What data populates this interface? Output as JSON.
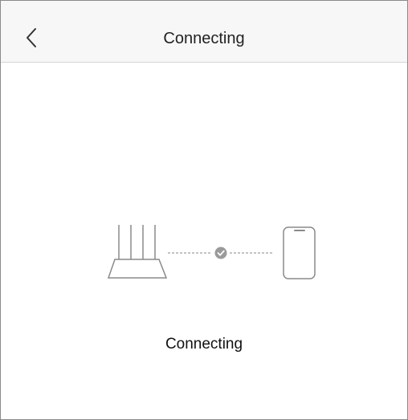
{
  "header": {
    "title": "Connecting",
    "back_icon": "chevron-left-icon"
  },
  "illustration": {
    "router_icon": "router-icon",
    "link_status_icon": "check-circle-icon",
    "phone_icon": "phone-icon",
    "line_color": "#8a8a8a",
    "check_color": "#9a9a9a"
  },
  "status": {
    "text": "Connecting"
  }
}
